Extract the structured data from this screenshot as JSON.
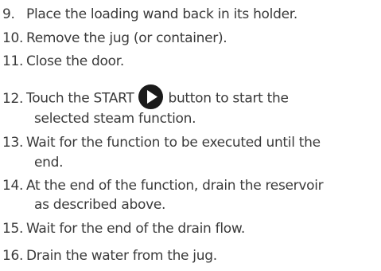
{
  "steps": [
    {
      "number": "9.",
      "text": "Place the loading wand back in its holder."
    },
    {
      "number": "10.",
      "text": "Remove the jug (or container)."
    },
    {
      "number": "11.",
      "text": "Close the door."
    },
    {
      "number": "12.",
      "text_before": "Touch the START",
      "icon": "play-icon",
      "text_after": "button to start the",
      "continuation": "selected steam function."
    },
    {
      "number": "13.",
      "text": "Wait for the function to be executed until the",
      "continuation": "end."
    },
    {
      "number": "14.",
      "text": "At the end of the function, drain the reservoir",
      "continuation": "as described above."
    },
    {
      "number": "15.",
      "text": "Wait for the end of the drain flow."
    },
    {
      "number": "16.",
      "text": "Drain the water from the jug."
    }
  ]
}
